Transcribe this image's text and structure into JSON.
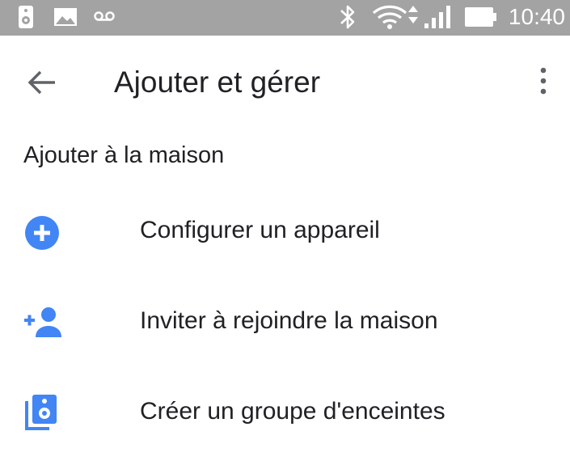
{
  "status_bar": {
    "time": "10:40",
    "icons": [
      "speaker-notification-icon",
      "image-notification-icon",
      "voicemail-icon",
      "bluetooth-icon",
      "wifi-icon",
      "cell-signal-icon",
      "battery-icon"
    ]
  },
  "app_bar": {
    "title": "Ajouter et gérer",
    "back_icon": "arrow-back-icon",
    "menu_icon": "more-vert-icon"
  },
  "section": {
    "title": "Ajouter à la maison"
  },
  "items": [
    {
      "label": "Configurer un appareil",
      "icon": "add-circle-icon"
    },
    {
      "label": "Inviter à rejoindre la maison",
      "icon": "person-add-icon"
    },
    {
      "label": "Créer un groupe d'enceintes",
      "icon": "speaker-group-icon"
    }
  ],
  "colors": {
    "status_bar": "#a3a3a3",
    "accent": "#4285f4",
    "text": "#202124",
    "icon_gray": "#5f6368"
  }
}
